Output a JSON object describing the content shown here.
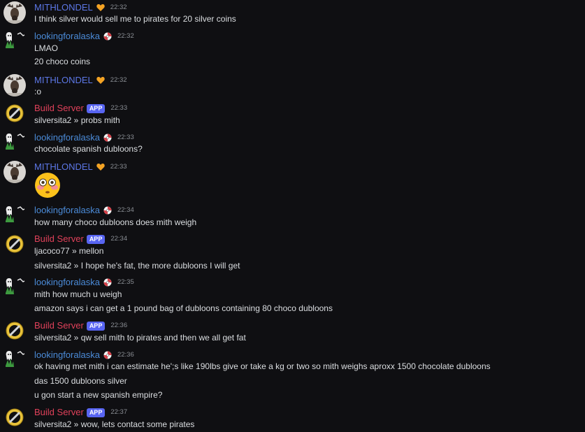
{
  "users": {
    "mith": "MITHLONDEL",
    "looking": "lookingforalaska",
    "bot": "Build Server",
    "app_tag": "APP"
  },
  "icons": {
    "mith_avatar": "moose-avatar-icon",
    "looking_avatar": "ghost-grass-avatar-icon",
    "bot_avatar": "gold-ring-avatar-icon",
    "mith_badge": "orange-heart-icon",
    "looking_badge": "red-white-ball-icon"
  },
  "colors": {
    "background": "#0f0f12",
    "mith_name": "#5c77e6",
    "looking_name": "#4b8bd8",
    "bot_name": "#e0415a",
    "app_tag": "#5865f2",
    "text": "#dbdee1",
    "timestamp": "#8a8e94"
  },
  "messages": [
    {
      "time": "22:32",
      "lines": [
        "I think silver would sell me to pirates for 20 silver coins"
      ]
    },
    {
      "time": "22:32",
      "lines": [
        "LMAO",
        "20 choco coins"
      ]
    },
    {
      "time": "22:32",
      "lines": [
        ":o"
      ]
    },
    {
      "time": "22:33",
      "lines": [
        "silversita2 »  probs mith"
      ]
    },
    {
      "time": "22:33",
      "lines": [
        "chocolate spanish dubloons?"
      ]
    },
    {
      "time": "22:33",
      "emoji": "flushed-face-emoji"
    },
    {
      "time": "22:34",
      "lines": [
        "how many choco dubloons does mith weigh"
      ]
    },
    {
      "time": "22:34",
      "lines": [
        "ljacoco77 »  mellon",
        "silversita2 »  I hope he's fat, the more dubloons I will get"
      ]
    },
    {
      "time": "22:35",
      "lines": [
        "mith how much u weigh",
        "amazon says i can get a 1 pound bag of dubloons containing 80 choco dubloons"
      ]
    },
    {
      "time": "22:36",
      "lines": [
        "silversita2 »  qw sell mith to pirates and then we all get fat"
      ]
    },
    {
      "time": "22:36",
      "lines": [
        "ok having met mith i can estimate he';s like 190lbs give or take a kg or two so mith weighs aproxx 1500 chocolate dubloons",
        "das 1500 dubloons silver",
        "u gon start a new spanish empire?"
      ]
    },
    {
      "time": "22:37",
      "lines": [
        "silversita2 »  wow, lets contact some pirates"
      ]
    }
  ]
}
